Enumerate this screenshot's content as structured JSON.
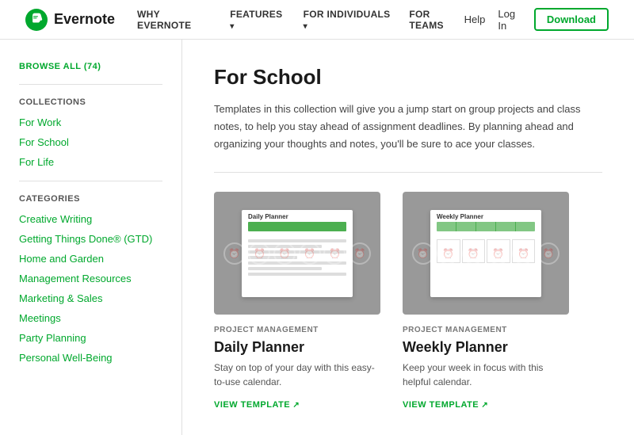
{
  "nav": {
    "brand": "Evernote",
    "links": [
      {
        "label": "Why Evernote",
        "hasArrow": false
      },
      {
        "label": "Features",
        "hasArrow": true
      },
      {
        "label": "For Individuals",
        "hasArrow": true
      },
      {
        "label": "For Teams",
        "hasArrow": false
      }
    ],
    "help": "Help",
    "login": "Log In",
    "download": "Download"
  },
  "sidebar": {
    "browse_all": "Browse All (74)",
    "collections_title": "Collections",
    "collections": [
      {
        "label": "For Work"
      },
      {
        "label": "For School"
      },
      {
        "label": "For Life"
      }
    ],
    "categories_title": "Categories",
    "categories": [
      {
        "label": "Creative Writing"
      },
      {
        "label": "Getting Things Done® (GTD)"
      },
      {
        "label": "Home and Garden"
      },
      {
        "label": "Management Resources"
      },
      {
        "label": "Marketing & Sales"
      },
      {
        "label": "Meetings"
      },
      {
        "label": "Party Planning"
      },
      {
        "label": "Personal Well-Being"
      }
    ]
  },
  "main": {
    "title": "For School",
    "description": "Templates in this collection will give you a jump start on group projects and class notes, to help you stay ahead of assignment deadlines. By planning ahead and organizing your thoughts and notes, you'll be sure to ace your classes.",
    "cards": [
      {
        "category": "Project Management",
        "title": "Daily Planner",
        "description": "Stay on top of your day with this easy-to-use calendar.",
        "link": "View Template"
      },
      {
        "category": "Project Management",
        "title": "Weekly Planner",
        "description": "Keep your week in focus with this helpful calendar.",
        "link": "View Template"
      }
    ]
  }
}
